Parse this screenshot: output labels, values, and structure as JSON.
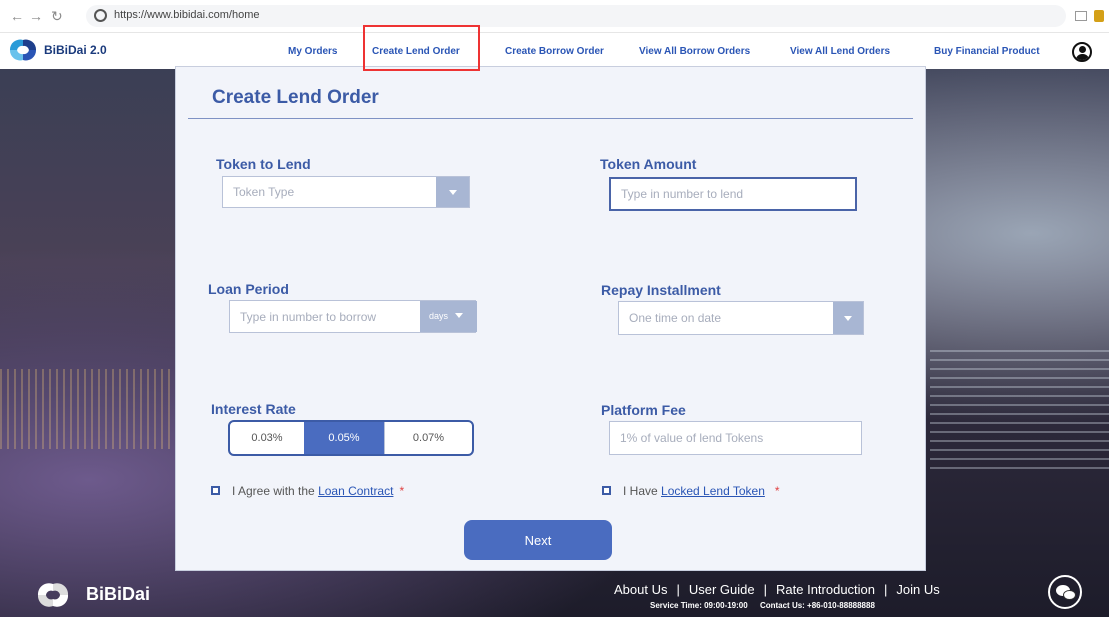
{
  "browser": {
    "url": "https://www.bibidai.com/home"
  },
  "nav": {
    "logo": "BiBiDai 2.0",
    "links": [
      "My Orders",
      "Create Lend Order",
      "Create Borrow  Order",
      "View All  Borrow Orders",
      "View All Lend Orders",
      "Buy Financial Product"
    ],
    "active": "Create Lend Order"
  },
  "form": {
    "title": "Create Lend Order",
    "token_to_lend": {
      "label": "Token to Lend",
      "placeholder": "Token Type"
    },
    "token_amount": {
      "label": "Token Amount",
      "placeholder": "Type in number to lend"
    },
    "loan_period": {
      "label": "Loan  Period",
      "placeholder": "Type in number to borrow",
      "unit": "days"
    },
    "repay_installment": {
      "label": "Repay Installment",
      "value": "One time on date"
    },
    "interest_rate": {
      "label": "Interest Rate",
      "options": [
        "0.03%",
        "0.05%",
        "0.07%"
      ],
      "selected": "0.05%"
    },
    "platform_fee": {
      "label": "Platform Fee",
      "placeholder": "1% of value of lend Tokens"
    },
    "agree_contract": {
      "prefix": "I Agree with the ",
      "link": "Loan Contract",
      "required": "*"
    },
    "locked_token": {
      "prefix": "I Have ",
      "link": "Locked Lend Token",
      "required": "*"
    },
    "next_label": "Next"
  },
  "footer": {
    "brand": "BiBiDai",
    "links": [
      "About Us",
      "User Guide",
      "Rate Introduction",
      "Join Us"
    ],
    "separator": "|",
    "service": "Service Time: 09:00-19:00",
    "contact": "Contact Us: +86-010-88888888"
  },
  "colors": {
    "primary": "#3c5ba6",
    "button": "#4a6cc0",
    "highlight": "#e33333"
  }
}
